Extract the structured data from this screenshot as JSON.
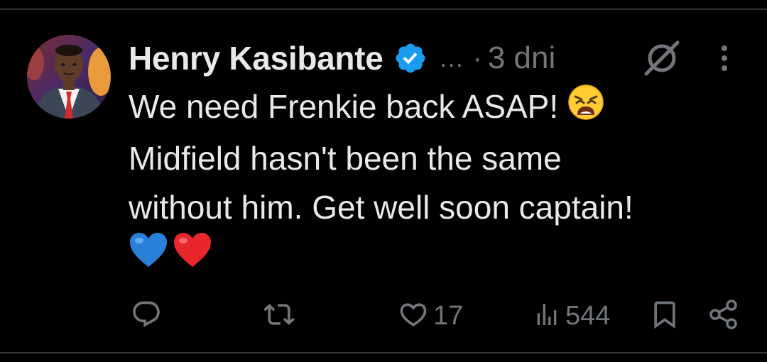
{
  "tweet": {
    "author_name": "Henry Kasibante",
    "ellipsis": "…",
    "separator": "·",
    "time": "3 dni",
    "text_line1": "We need Frenkie back ASAP!",
    "text_line2": "Midfield hasn't been the same",
    "text_line3": "without him. Get well soon captain!"
  },
  "actions": {
    "likes": "17",
    "views": "544"
  },
  "icons": {
    "verified": "verified-badge-icon",
    "grok": "grok-icon",
    "more": "more-vertical-icon",
    "reply": "reply-icon",
    "retweet": "retweet-icon",
    "like": "heart-icon",
    "views": "views-icon",
    "bookmark": "bookmark-icon",
    "share": "share-icon",
    "emoji_weary": "weary-face-emoji",
    "emoji_blue_heart": "blue-heart-emoji",
    "emoji_red_heart": "red-heart-emoji"
  },
  "colors": {
    "background": "#000000",
    "text": "#e7e9ea",
    "muted": "#71767b",
    "verified": "#1d9bf0",
    "divider": "#2f3336"
  }
}
